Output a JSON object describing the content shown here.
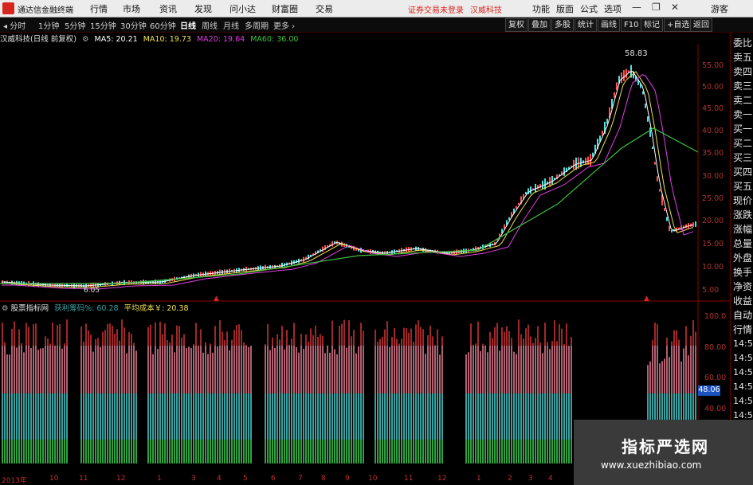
{
  "titlebar": {
    "app_title": "通达信金融终端",
    "menu": [
      "行情",
      "市场",
      "资讯",
      "发现",
      "问小达",
      "财富圈",
      "交易"
    ],
    "login_status": "证券交易未登录",
    "stock_name": "汉威科技",
    "right_menu": [
      "功能",
      "版面",
      "公式",
      "选项"
    ],
    "guest": "游客"
  },
  "periodbar": {
    "tabs": [
      "分时",
      "1分钟",
      "5分钟",
      "15分钟",
      "30分钟",
      "60分钟",
      "日线",
      "周线",
      "月线",
      "多周期",
      "更多"
    ],
    "active": "日线",
    "buttons": [
      "复权",
      "叠加",
      "多股",
      "统计",
      "画线",
      "F10",
      "标记",
      "+自选",
      "返回"
    ]
  },
  "infobar": {
    "title": "汉威科技(日线 前复权)",
    "ma5": "MA5: 20.21",
    "ma10": "MA10: 19.73",
    "ma20": "MA20: 19.64",
    "ma60": "MA60: 36.00"
  },
  "price_axis": [
    "55.00",
    "50.00",
    "45.00",
    "40.00",
    "35.00",
    "30.00",
    "25.00",
    "20.00",
    "15.00",
    "10.00",
    "5.00"
  ],
  "price_annotations": {
    "high": "58.83",
    "low": "6.05"
  },
  "indicator": {
    "name": "股票指标网",
    "profit_ratio": "获利筹码%: 60.28",
    "avg_cost": "平均成本￥: 20.38",
    "axis": [
      "100.0",
      "80.00",
      "60.00",
      "40.00"
    ],
    "current_value": "48.06"
  },
  "right_panel": {
    "labels": [
      "委比",
      "卖五",
      "卖四",
      "卖三",
      "卖二",
      "卖一",
      "买一",
      "买二",
      "买三",
      "买四",
      "买五",
      "现价",
      "涨跌",
      "涨幅",
      "总量",
      "外盘",
      "换手",
      "净资",
      "收益"
    ],
    "labels2": [
      "自动",
      "行情",
      "14:5",
      "14:5",
      "14:5",
      "14:5",
      "14:5",
      "14:5"
    ]
  },
  "x_axis": [
    "2013年",
    "10",
    "11",
    "12",
    "1",
    "3",
    "4",
    "5",
    "6",
    "7",
    "8",
    "9",
    "10",
    "11",
    "12",
    "1",
    "2",
    "3",
    "4"
  ],
  "watermark": {
    "line1": "指标严选网",
    "line2": "www.xuezhibiao.com"
  },
  "colors": {
    "red": "#d6261d",
    "ma5": "#ffffff",
    "ma10": "#f0e050",
    "ma20": "#e040e0",
    "ma60": "#40c040",
    "teal": "#3aa0a0",
    "pink": "#b06070",
    "green_band": "#30a040"
  }
}
